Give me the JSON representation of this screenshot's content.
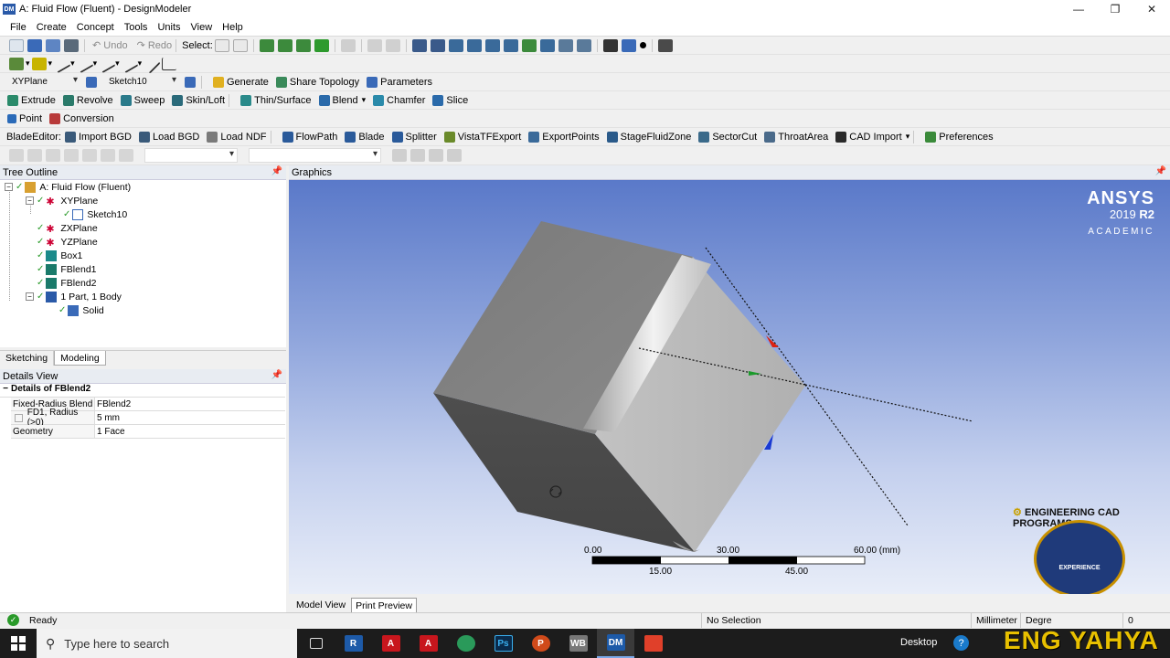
{
  "window": {
    "title": "A: Fluid Flow (Fluent) - DesignModeler",
    "app_badge": "DM"
  },
  "menu": [
    "File",
    "Create",
    "Concept",
    "Tools",
    "Units",
    "View",
    "Help"
  ],
  "toolbar1": {
    "undo": "Undo",
    "redo": "Redo",
    "select_label": "Select:"
  },
  "toolbar3": {
    "plane": "XYPlane",
    "sketch": "Sketch10",
    "generate": "Generate",
    "share_topology": "Share Topology",
    "parameters": "Parameters"
  },
  "toolbar4": {
    "extrude": "Extrude",
    "revolve": "Revolve",
    "sweep": "Sweep",
    "skin_loft": "Skin/Loft",
    "thin_surface": "Thin/Surface",
    "blend": "Blend",
    "chamfer": "Chamfer",
    "slice": "Slice"
  },
  "toolbar5": {
    "point": "Point",
    "conversion": "Conversion"
  },
  "blade_toolbar": {
    "label": "BladeEditor:",
    "import_bgd": "Import BGD",
    "load_bgd": "Load BGD",
    "load_ndf": "Load NDF",
    "flowpath": "FlowPath",
    "blade": "Blade",
    "splitter": "Splitter",
    "vistatf": "VistaTFExport",
    "export_points": "ExportPoints",
    "stage_fluid": "StageFluidZone",
    "sector_cut": "SectorCut",
    "throat_area": "ThroatArea",
    "cad_import": "CAD Import",
    "preferences": "Preferences"
  },
  "tree": {
    "header": "Tree Outline",
    "root": "A: Fluid Flow (Fluent)",
    "items": [
      "XYPlane",
      "Sketch10",
      "ZXPlane",
      "YZPlane",
      "Box1",
      "FBlend1",
      "FBlend2",
      "1 Part, 1 Body",
      "Solid"
    ]
  },
  "tabs": {
    "sketching": "Sketching",
    "modeling": "Modeling"
  },
  "details": {
    "header": "Details View",
    "title": "Details of FBlend2",
    "rows": [
      {
        "k": "Fixed-Radius Blend",
        "v": "FBlend2"
      },
      {
        "k": "FD1, Radius (>0)",
        "v": "5 mm"
      },
      {
        "k": "Geometry",
        "v": "1 Face"
      }
    ]
  },
  "graphics": {
    "header": "Graphics",
    "brand": "ANSYS",
    "version_year": "2019",
    "version_rel": "R2",
    "edition": "ACADEMIC",
    "scale_top": [
      "0.00",
      "30.00",
      "60.00 (mm)"
    ],
    "scale_bottom": [
      "15.00",
      "45.00"
    ]
  },
  "overlay": {
    "channel_text": "ENGINEERING CAD PROGRAMS",
    "badge_text": "EXPERIENCE",
    "signature": "ENG YAHYA"
  },
  "bottom_tabs": {
    "model_view": "Model View",
    "print_preview": "Print Preview"
  },
  "status": {
    "ready": "Ready",
    "selection": "No Selection",
    "units": "Millimeter",
    "angle": "Degre",
    "count": "0"
  },
  "taskbar": {
    "search": "Type here to search",
    "desktop": "Desktop"
  }
}
